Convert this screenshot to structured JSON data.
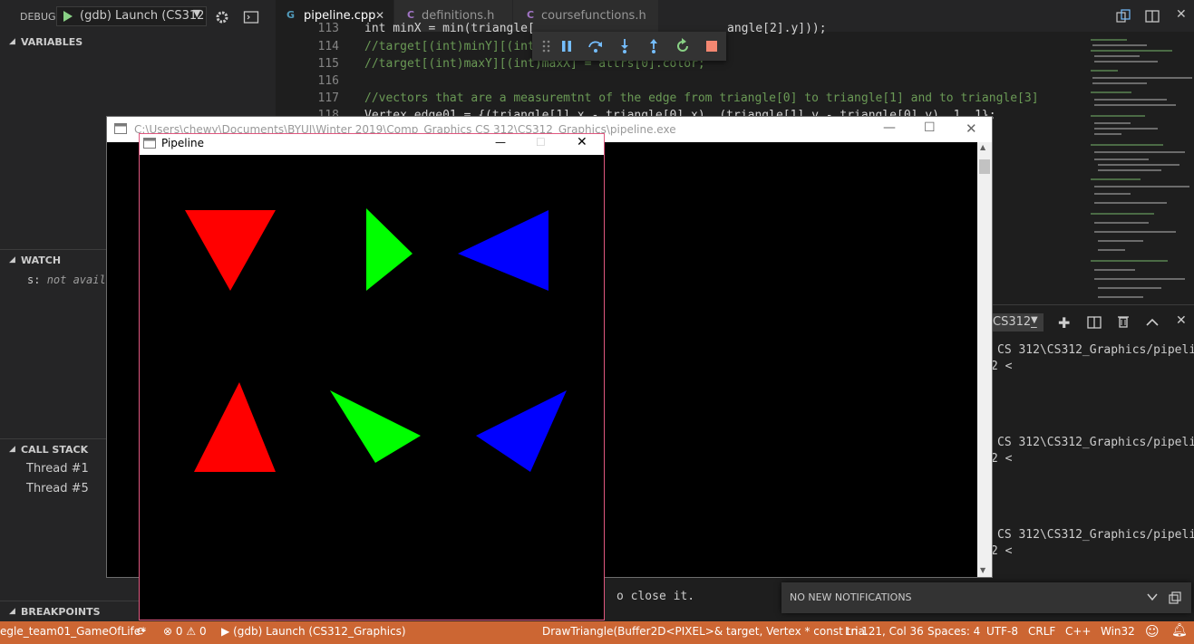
{
  "debug": {
    "label": "DEBUG",
    "config": "(gdb) Launch (CS312",
    "sections": {
      "variables": "VARIABLES",
      "watch": "WATCH",
      "call_stack": "CALL STACK",
      "breakpoints": "BREAKPOINTS"
    },
    "watch_items": [
      {
        "name": "s:",
        "value": "not availa"
      }
    ],
    "threads": [
      "Thread #1",
      "Thread #5"
    ]
  },
  "tabs": [
    {
      "name": "pipeline.cpp",
      "icon": "C++",
      "active": true
    },
    {
      "name": "definitions.h",
      "icon": "C",
      "active": false
    },
    {
      "name": "coursefunctions.h",
      "icon": "C",
      "active": false
    }
  ],
  "code_lines": [
    {
      "num": "113",
      "text": "int minX = min(triangle[",
      "tail": "angle[2].y]));"
    },
    {
      "num": "114",
      "text": "//target[(int)minY][(int",
      "tail": ""
    },
    {
      "num": "115",
      "text": "//target[(int)maxY][(int)maxX] = attrs[0].color;",
      "tail": ""
    },
    {
      "num": "116",
      "text": "",
      "tail": ""
    },
    {
      "num": "117",
      "text": "//vectors that are a measuremtnt of the edge from triangle[0] to triangle[1] and to triangle[3]",
      "tail": ""
    },
    {
      "num": "118",
      "text": "Vertex edge01 = {(triangle[1].x - triangle[0].x), (triangle[1].y - triangle[0].y), 1, 1};",
      "tail": ""
    }
  ],
  "console_window": {
    "title": "C:\\Users\\chewy\\Documents\\BYUI\\Winter 2019\\Comp_Graphics CS 312\\CS312_Graphics\\pipeline.exe"
  },
  "pipeline_window": {
    "title": "Pipeline"
  },
  "terminal": {
    "selected": "CS312_",
    "lines": [
      {
        "text": "CS 312\\CS312_Graphics/pipeli",
        "prompt": "2 <"
      },
      {
        "text": "CS 312\\CS312_Graphics/pipeli",
        "prompt": "2 <"
      },
      {
        "text": "CS 312\\CS312_Graphics/pipeli",
        "prompt": "2 <"
      }
    ],
    "behind_text": "o close it."
  },
  "notifications": {
    "text": "NO NEW NOTIFICATIONS"
  },
  "statusbar": {
    "branch": "egle_team01_GameOfLife*",
    "errors": "0",
    "warnings": "0",
    "launch": "(gdb) Launch (CS312_Graphics)",
    "function": "DrawTriangle(Buffer2D<PIXEL>& target, Vertex * const tria...",
    "position": "Ln 121, Col 36",
    "spaces": "Spaces: 4",
    "encoding": "UTF-8",
    "eol": "CRLF",
    "language": "C++",
    "platform": "Win32"
  },
  "colors": {
    "red": "#ff0000",
    "green": "#00ff00",
    "blue": "#0000ff",
    "statusbar": "#cc6633",
    "comment": "#6a9955"
  },
  "icons": [
    "play-icon",
    "gear-icon",
    "terminal-icon",
    "pause-icon",
    "step-over-icon",
    "step-into-icon",
    "step-out-icon",
    "restart-icon",
    "stop-icon",
    "plus-icon",
    "split-icon",
    "trash-icon",
    "chevron-up-icon",
    "close-icon",
    "bell-icon",
    "smiley-icon"
  ]
}
